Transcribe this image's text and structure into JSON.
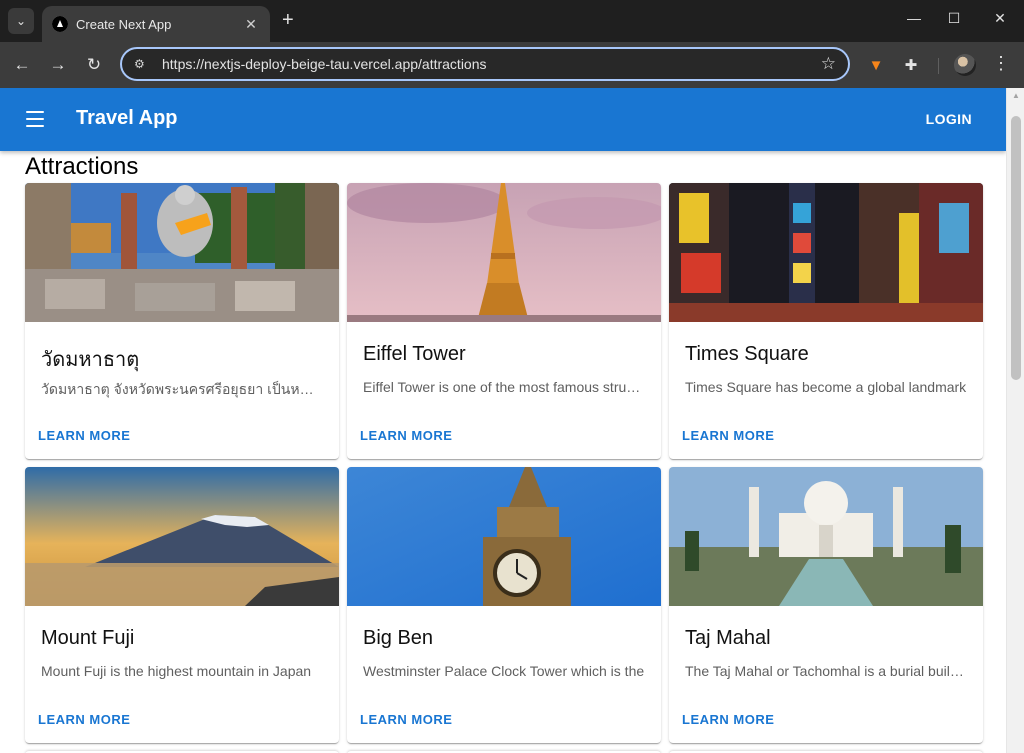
{
  "browser": {
    "tab_title": "Create Next App",
    "tab_close": "✕",
    "new_tab": "+",
    "url": "https://nextjs-deploy-beige-tau.vercel.app/attractions",
    "window_controls": {
      "minimize": "—",
      "maximize": "☐",
      "close": "✕"
    },
    "icons": [
      "back-icon",
      "forward-icon",
      "reload-icon",
      "site-settings-icon",
      "star-icon",
      "metamask-fox-icon",
      "extensions-puzzle-icon",
      "profile-avatar",
      "more-menu-icon"
    ]
  },
  "app": {
    "title": "Travel App",
    "login_label": "LOGIN",
    "accent_color": "#1976d2"
  },
  "page": {
    "heading": "Attractions"
  },
  "attractions": [
    {
      "title": "วัดมหาธาตุ",
      "description": "วัดมหาธาตุ จังหวัดพระนครศรีอยุธยา เป็นหนึ่งในวัดสำคัญ",
      "action": "LEARN MORE",
      "image": "buddha-temple-image"
    },
    {
      "title": "Eiffel Tower",
      "description": "Eiffel Tower is one of the most famous structures",
      "action": "LEARN MORE",
      "image": "eiffel-tower-image"
    },
    {
      "title": "Times Square",
      "description": "Times Square has become a global landmark",
      "action": "LEARN MORE",
      "image": "times-square-image"
    },
    {
      "title": "Mount Fuji",
      "description": "Mount Fuji is the highest mountain in Japan",
      "action": "LEARN MORE",
      "image": "mount-fuji-image"
    },
    {
      "title": "Big Ben",
      "description": "Westminster Palace Clock Tower which is the",
      "action": "LEARN MORE",
      "image": "big-ben-image"
    },
    {
      "title": "Taj Mahal",
      "description": "The Taj Mahal or Tachomhal is a burial building",
      "action": "LEARN MORE",
      "image": "taj-mahal-image"
    }
  ]
}
